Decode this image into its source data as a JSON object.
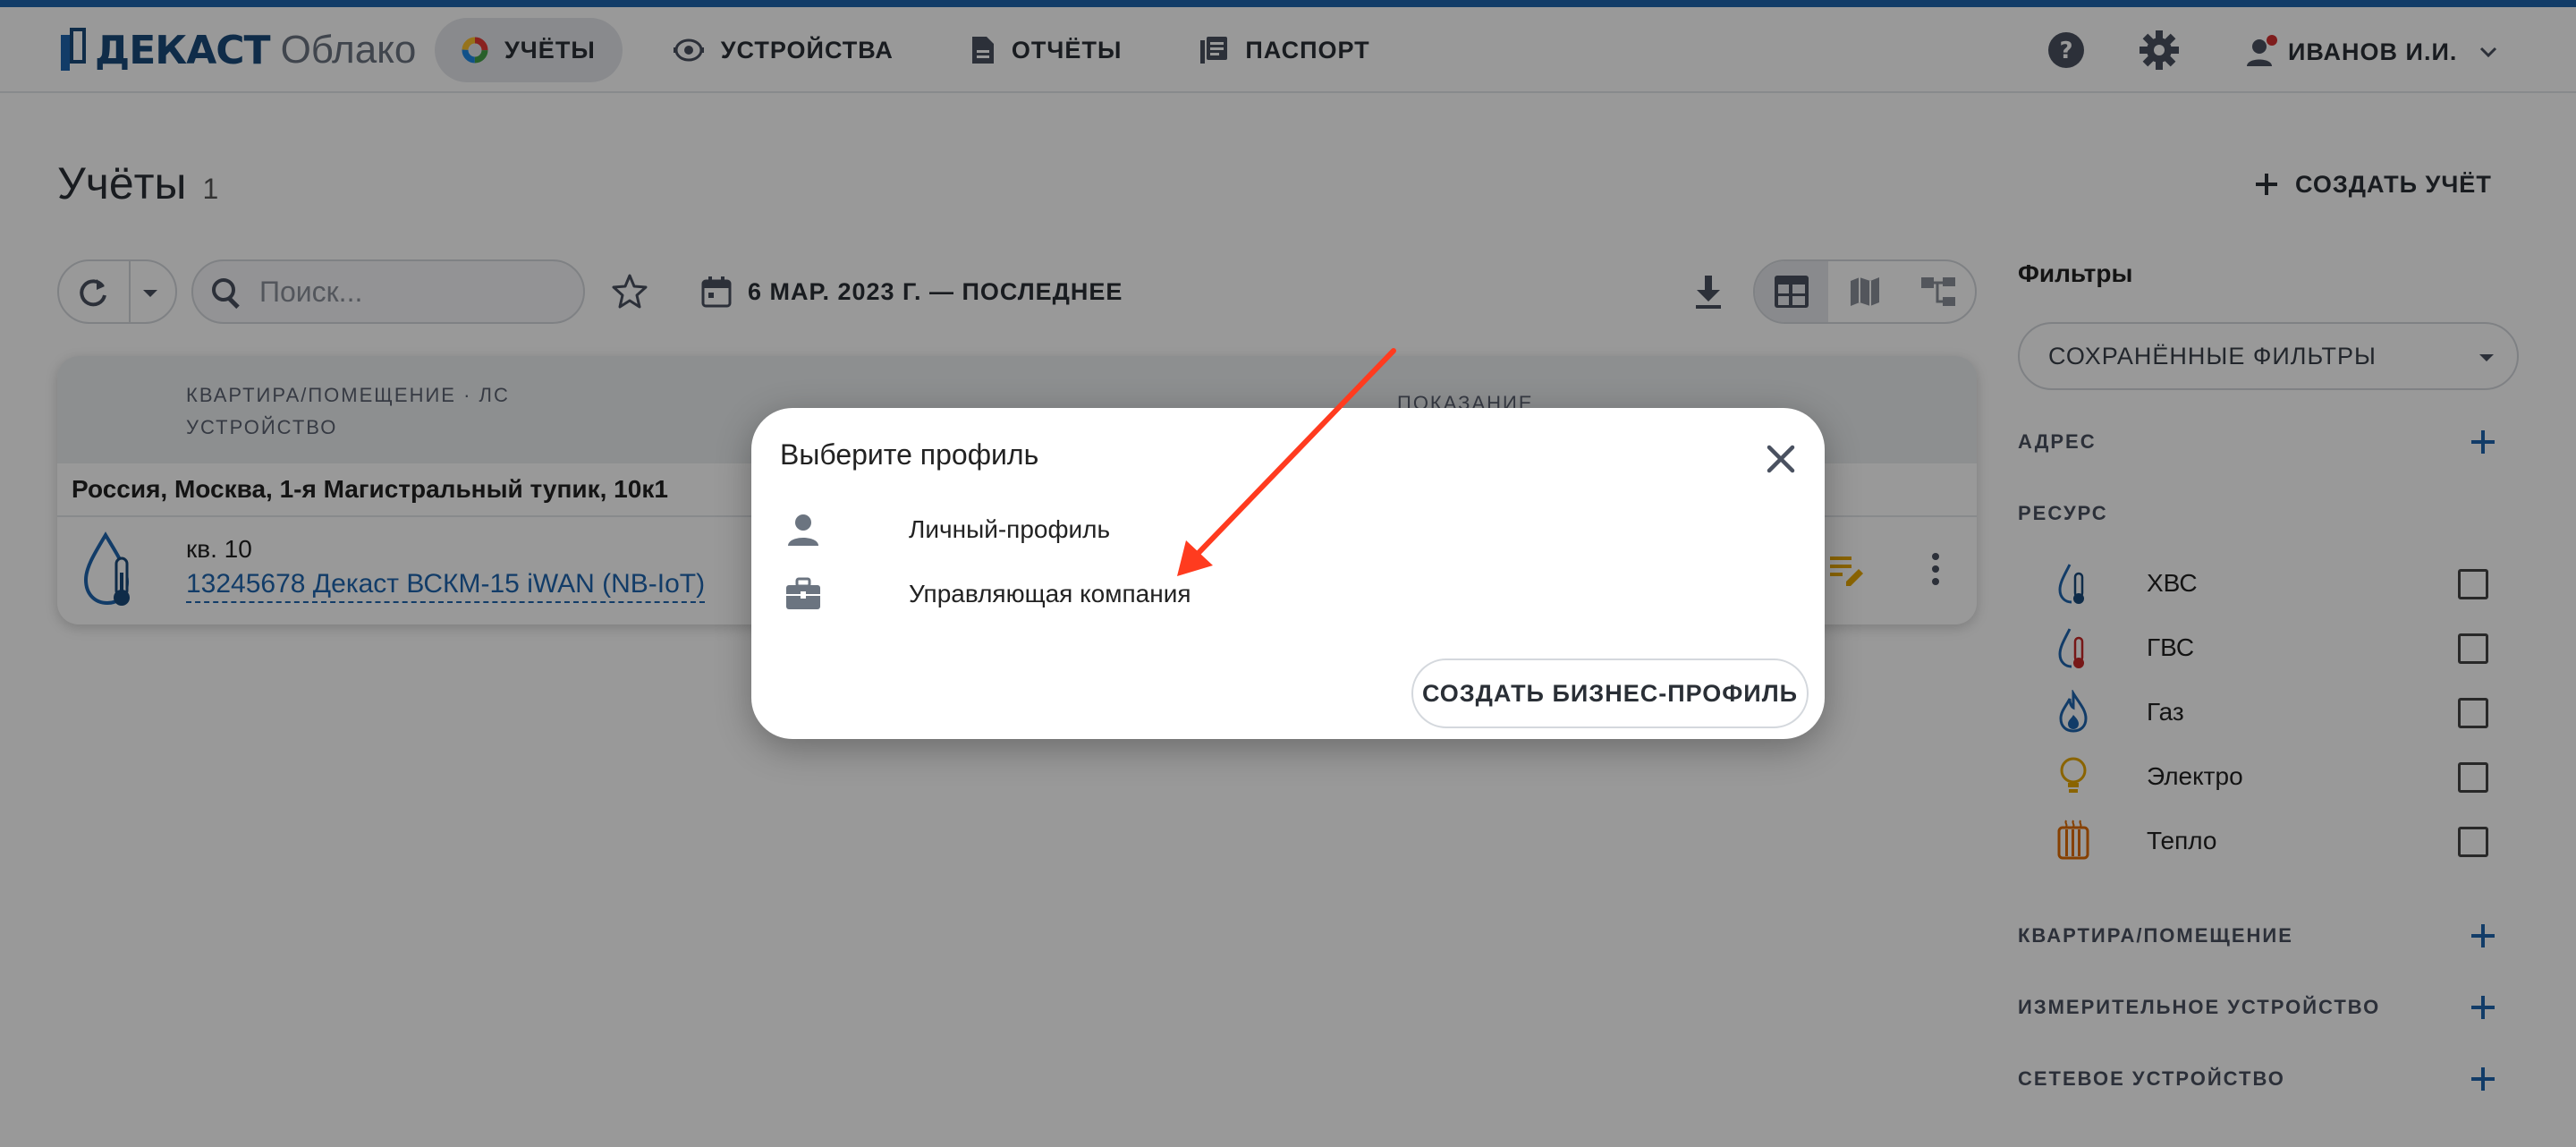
{
  "header": {
    "brand": "ДЕКАСТ",
    "brand_sub": "Облако",
    "nav": [
      {
        "label": "УЧЁТЫ",
        "icon": "accounts-pie-icon",
        "active": true
      },
      {
        "label": "УСТРОЙСТВА",
        "icon": "device-meter-icon"
      },
      {
        "label": "ОТЧЁТЫ",
        "icon": "report-document-icon"
      },
      {
        "label": "ПАСПОРТ",
        "icon": "passport-book-icon"
      }
    ],
    "user_name": "ИВАНОВ И.И."
  },
  "main": {
    "title": "Учёты",
    "count": "1",
    "create_label": "СОЗДАТЬ УЧЁТ",
    "search_placeholder": "Поиск...",
    "date_range": "6 МАР. 2023 Г. — ПОСЛЕДНЕЕ",
    "table": {
      "col_primary": "КВАРТИРА/ПОМЕЩЕНИЕ · ЛС",
      "col_secondary": "УСТРОЙСТВО",
      "col_reading": "ПОКАЗАНИЕ",
      "address": "Россия, Москва, 1-я Магистральный тупик, 10к1",
      "flat": "кв. 10",
      "device": "13245678 Декаст ВСКМ-15 iWAN (NB-IoT)"
    }
  },
  "filters": {
    "title": "Фильтры",
    "saved_label": "СОХРАНЁННЫЕ ФИЛЬТРЫ",
    "address_label": "АДРЕС",
    "resource_label": "РЕСУРС",
    "resources": [
      {
        "label": "ХВС",
        "icon": "cold-water-icon",
        "color": "#1f65ad"
      },
      {
        "label": "ГВС",
        "icon": "hot-water-icon",
        "color": "#c62828"
      },
      {
        "label": "Газ",
        "icon": "gas-flame-icon",
        "color": "#1f65ad"
      },
      {
        "label": "Электро",
        "icon": "light-bulb-icon",
        "color": "#e6a700"
      },
      {
        "label": "Тепло",
        "icon": "radiator-icon",
        "color": "#e06c00"
      }
    ],
    "flat_label": "КВАРТИРА/ПОМЕЩЕНИЕ",
    "meter_label": "ИЗМЕРИТЕЛЬНОЕ УСТРОЙСТВО",
    "network_label": "СЕТЕВОЕ УСТРОЙСТВО"
  },
  "modal": {
    "title": "Выберите профиль",
    "items": [
      {
        "label": "Личный-профиль",
        "icon": "person-icon"
      },
      {
        "label": "Управляющая компания",
        "icon": "briefcase-icon"
      }
    ],
    "create_business_label": "СОЗДАТЬ БИЗНЕС-ПРОФИЛЬ"
  },
  "colors": {
    "accent": "#1f65ad",
    "annotation_arrow": "#ff3b1f"
  }
}
